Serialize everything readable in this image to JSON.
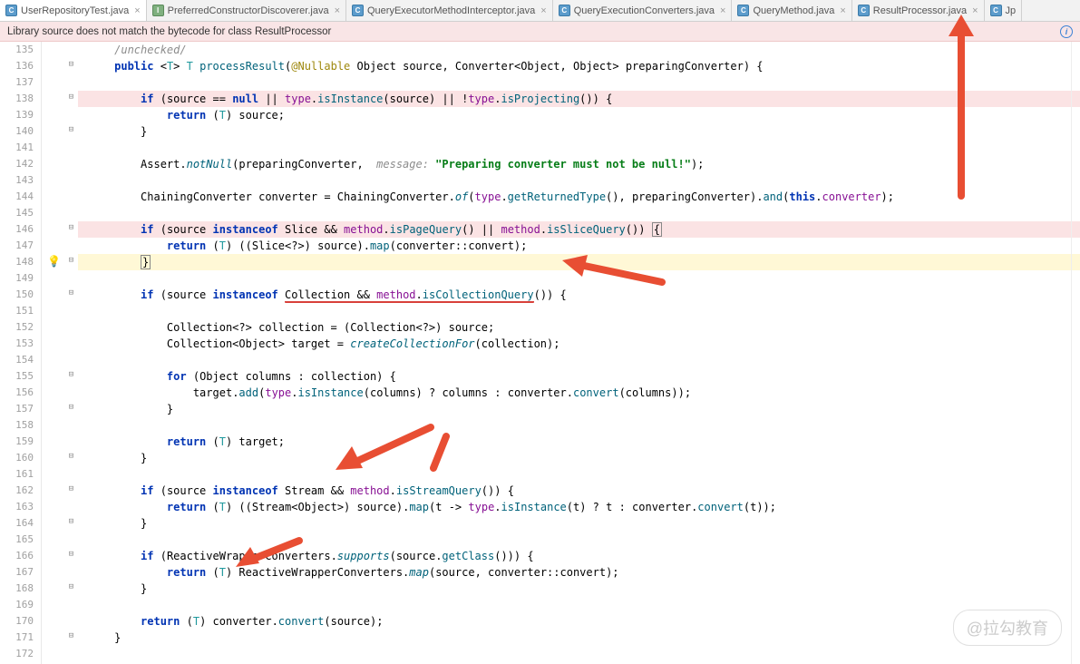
{
  "tabs": [
    {
      "icon": "C",
      "label": "UserRepositoryTest.java",
      "active": true
    },
    {
      "icon": "I",
      "label": "PreferredConstructorDiscoverer.java",
      "active": false
    },
    {
      "icon": "C",
      "label": "QueryExecutorMethodInterceptor.java",
      "active": false
    },
    {
      "icon": "C",
      "label": "QueryExecutionConverters.java",
      "active": false
    },
    {
      "icon": "C",
      "label": "QueryMethod.java",
      "active": false
    },
    {
      "icon": "C",
      "label": "ResultProcessor.java",
      "active": false
    },
    {
      "icon": "C",
      "label": "Jp",
      "active": false
    }
  ],
  "warning": "Library source does not match the bytecode for class ResultProcessor",
  "watermark": "@拉勾教育",
  "first_line": 135,
  "breakpoints": [
    138,
    146
  ],
  "bulb_line": 148,
  "code": {
    "l135": "/unchecked/",
    "l136": {
      "kw_public": "public",
      "t_t": "T",
      "m": "processResult",
      "ann": "@Nullable",
      "t_obj": "Object",
      "p_src": "source",
      "t_conv": "Converter",
      "t_obj2": "Object",
      "t_obj3": "Object",
      "p_conv": "preparingConverter"
    },
    "l138": {
      "kw_if": "if",
      "p": "source",
      "kw_null": "null",
      "f": "type",
      "m1": "isInstance",
      "m2": "isProjecting"
    },
    "l139": {
      "kw": "return",
      "t": "T",
      "v": "source"
    },
    "l142": {
      "c": "Assert",
      "m": "notNull",
      "p": "preparingConverter",
      "lbl": "message:",
      "s": "\"Preparing converter must not be null!\""
    },
    "l144": {
      "t": "ChainingConverter",
      "v": "converter",
      "m1": "of",
      "f": "type",
      "m2": "getReturnedType",
      "p": "preparingConverter",
      "m3": "and",
      "kw": "this",
      "f2": "converter"
    },
    "l146": {
      "kw_if": "if",
      "p": "source",
      "kw_io": "instanceof",
      "t": "Slice",
      "f": "method",
      "m1": "isPageQuery",
      "m2": "isSliceQuery"
    },
    "l147": {
      "kw": "return",
      "t": "T",
      "t2": "Slice",
      "p": "source",
      "m": "map",
      "v": "converter",
      "m2": "convert"
    },
    "l150": {
      "kw_if": "if",
      "p": "source",
      "kw_io": "instanceof",
      "t": "Collection",
      "f": "method",
      "m": "isCollectionQuery"
    },
    "l152": {
      "t": "Collection",
      "v": "collection",
      "t2": "Collection",
      "p": "source"
    },
    "l153": {
      "t": "Collection",
      "t2": "Object",
      "v": "target",
      "m": "createCollectionFor",
      "p": "collection"
    },
    "l155": {
      "kw": "for",
      "t": "Object",
      "v": "columns",
      "p": "collection"
    },
    "l156": {
      "v": "target",
      "m": "add",
      "f": "type",
      "m2": "isInstance",
      "p": "columns",
      "v2": "converter",
      "m3": "convert"
    },
    "l159": {
      "kw": "return",
      "t": "T",
      "v": "target"
    },
    "l162": {
      "kw_if": "if",
      "p": "source",
      "kw_io": "instanceof",
      "t": "Stream",
      "f": "method",
      "m": "isStreamQuery"
    },
    "l163": {
      "kw": "return",
      "t": "T",
      "t2": "Stream",
      "t3": "Object",
      "p": "source",
      "m": "map",
      "v": "t",
      "f": "type",
      "m2": "isInstance",
      "v2": "converter",
      "m3": "convert"
    },
    "l166": {
      "kw_if": "if",
      "c": "ReactiveWrapperConverters",
      "m": "supports",
      "p": "source",
      "m2": "getClass"
    },
    "l167": {
      "kw": "return",
      "t": "T",
      "c": "ReactiveWrapperConverters",
      "m": "map",
      "p": "source",
      "v": "converter",
      "m2": "convert"
    },
    "l170": {
      "kw": "return",
      "t": "T",
      "v": "converter",
      "m": "convert",
      "p": "source"
    }
  }
}
